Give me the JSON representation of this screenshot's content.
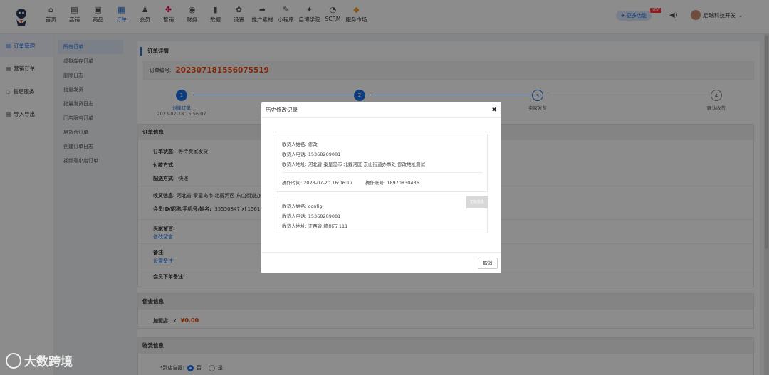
{
  "nav": [
    {
      "label": "首页",
      "icon": "home-icon",
      "glyph": "⌂"
    },
    {
      "label": "店铺",
      "icon": "store-icon",
      "glyph": "▤"
    },
    {
      "label": "商品",
      "icon": "goods-icon",
      "glyph": "▣"
    },
    {
      "label": "订单",
      "icon": "order-icon",
      "glyph": "▦",
      "active": true
    },
    {
      "label": "会员",
      "icon": "member-icon",
      "glyph": "♟"
    },
    {
      "label": "营销",
      "icon": "marketing-icon",
      "glyph": "✤"
    },
    {
      "label": "财务",
      "icon": "finance-icon",
      "glyph": "◉"
    },
    {
      "label": "数据",
      "icon": "data-icon",
      "glyph": "▮"
    },
    {
      "label": "设置",
      "icon": "settings-icon",
      "glyph": "✿"
    },
    {
      "label": "推广素材",
      "icon": "promo-icon",
      "glyph": "➦"
    },
    {
      "label": "小程序",
      "icon": "miniprogram-icon",
      "glyph": "✎"
    },
    {
      "label": "启博学院",
      "icon": "academy-icon",
      "glyph": "✦"
    },
    {
      "label": "SCRM",
      "icon": "scrm-icon",
      "glyph": "◔"
    },
    {
      "label": "服务市场",
      "icon": "service-market-icon",
      "glyph": "◆"
    }
  ],
  "header": {
    "more_label": "更多功能",
    "new_badge": "NEW",
    "user_name": "启瑞科技开发"
  },
  "side1": [
    "订单管理",
    "营销订单",
    "售后服务",
    "导入导出"
  ],
  "side2": [
    "所有订单",
    "虚拟库存订单",
    "删除日志",
    "批量发货",
    "批量发货日志",
    "门店服务订单",
    "启货仓订单",
    "创建订单日志",
    "视频号小店订单"
  ],
  "detail": {
    "title": "订单详情",
    "order_label": "订单编号:",
    "order_no": "202307181556075519"
  },
  "steps": [
    {
      "num": "1",
      "label": "创建订单",
      "date": "2023-07-18 15:56:07"
    },
    {
      "num": "2",
      "label": "",
      "date": ""
    },
    {
      "num": "3",
      "label": "卖家发货",
      "date": ""
    },
    {
      "num": "4",
      "label": "确认收货",
      "date": ""
    }
  ],
  "order_info": {
    "header": "订单信息",
    "status_label": "订单状态:",
    "status_value": "等待卖家发货",
    "pay_label": "付款方式:",
    "delivery_label": "配送方式:",
    "delivery_value": "快递",
    "receiver_label": "收货信息:",
    "receiver_value": "河北省 秦皇岛市 北戴河区 东山街道办事",
    "member_label": "会员ID/昵称/手机号/姓名:",
    "member_value": "35550847  xl  1561",
    "buyer_msg_label": "买家留言:",
    "buyer_msg_link": "修改留言",
    "remark_label": "备注:",
    "remark_link": "设置备注",
    "member_remark_label": "会员下单备注:"
  },
  "commission": {
    "header": "佣金信息",
    "label": "加盟店:",
    "member": "xl",
    "amount": "¥0.00"
  },
  "logistics": {
    "header": "物流信息",
    "pickup_label": "*到店自提:",
    "opt_no": "否",
    "opt_yes": "是"
  },
  "modal": {
    "title": "历史修改记录",
    "record1": {
      "name": "收货人姓名:  修改",
      "phone": "收货人电话:  15368209081",
      "address": "收货人地址:  河北省 秦皇岛市 北戴河区 东山街道办事处 修改地址测试",
      "time": "操作时间:  2023-07-20 16:06:17",
      "operator": "操作账号:  18970830436"
    },
    "record2": {
      "name": "收货人姓名:  config",
      "phone": "收货人电话:  15368209081",
      "address": "收货人地址:  江西省 赣州市 111",
      "tag": "初始信息"
    },
    "cancel_label": "取消"
  },
  "watermark": "大数跨境"
}
